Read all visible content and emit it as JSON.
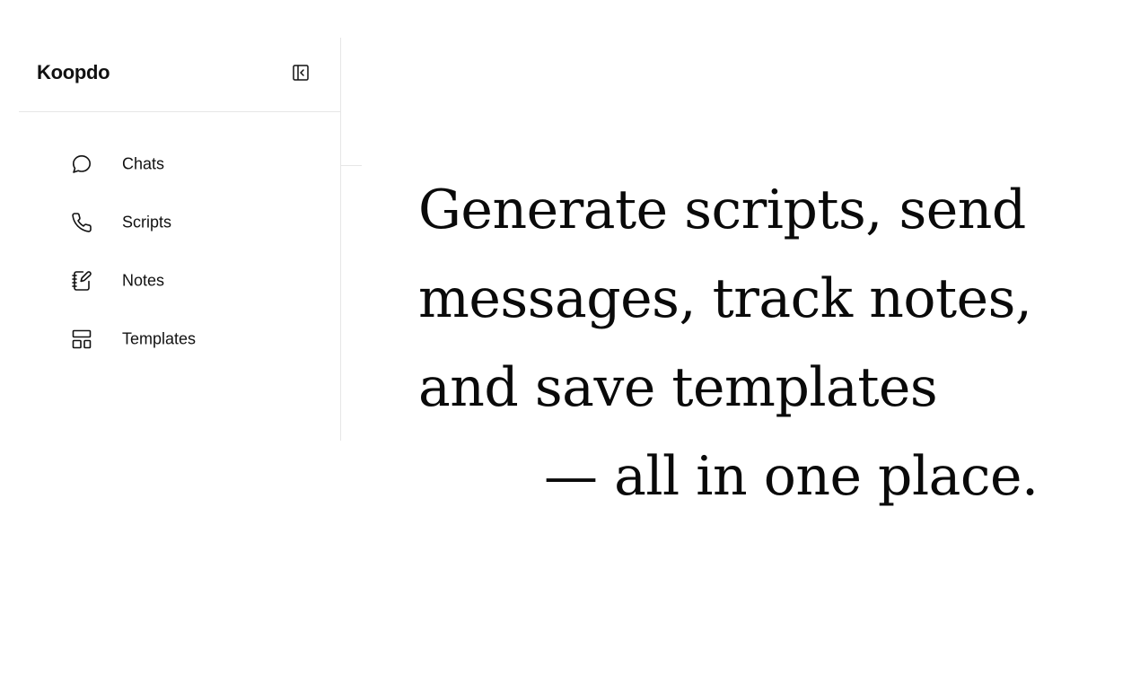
{
  "app": {
    "brand": "Koopdo"
  },
  "sidebar": {
    "collapse_icon": "sidebar-collapse-icon",
    "items": [
      {
        "label": "Chats",
        "icon": "chat-bubble-icon"
      },
      {
        "label": "Scripts",
        "icon": "phone-icon"
      },
      {
        "label": "Notes",
        "icon": "notebook-edit-icon"
      },
      {
        "label": "Templates",
        "icon": "layout-template-icon"
      }
    ]
  },
  "hero": {
    "lines": [
      "Generate scripts, send",
      "messages, track notes,",
      "and save templates",
      "— all in one place."
    ]
  },
  "colors": {
    "text": "#111111",
    "divider": "#e6e6e6",
    "background": "#ffffff"
  }
}
